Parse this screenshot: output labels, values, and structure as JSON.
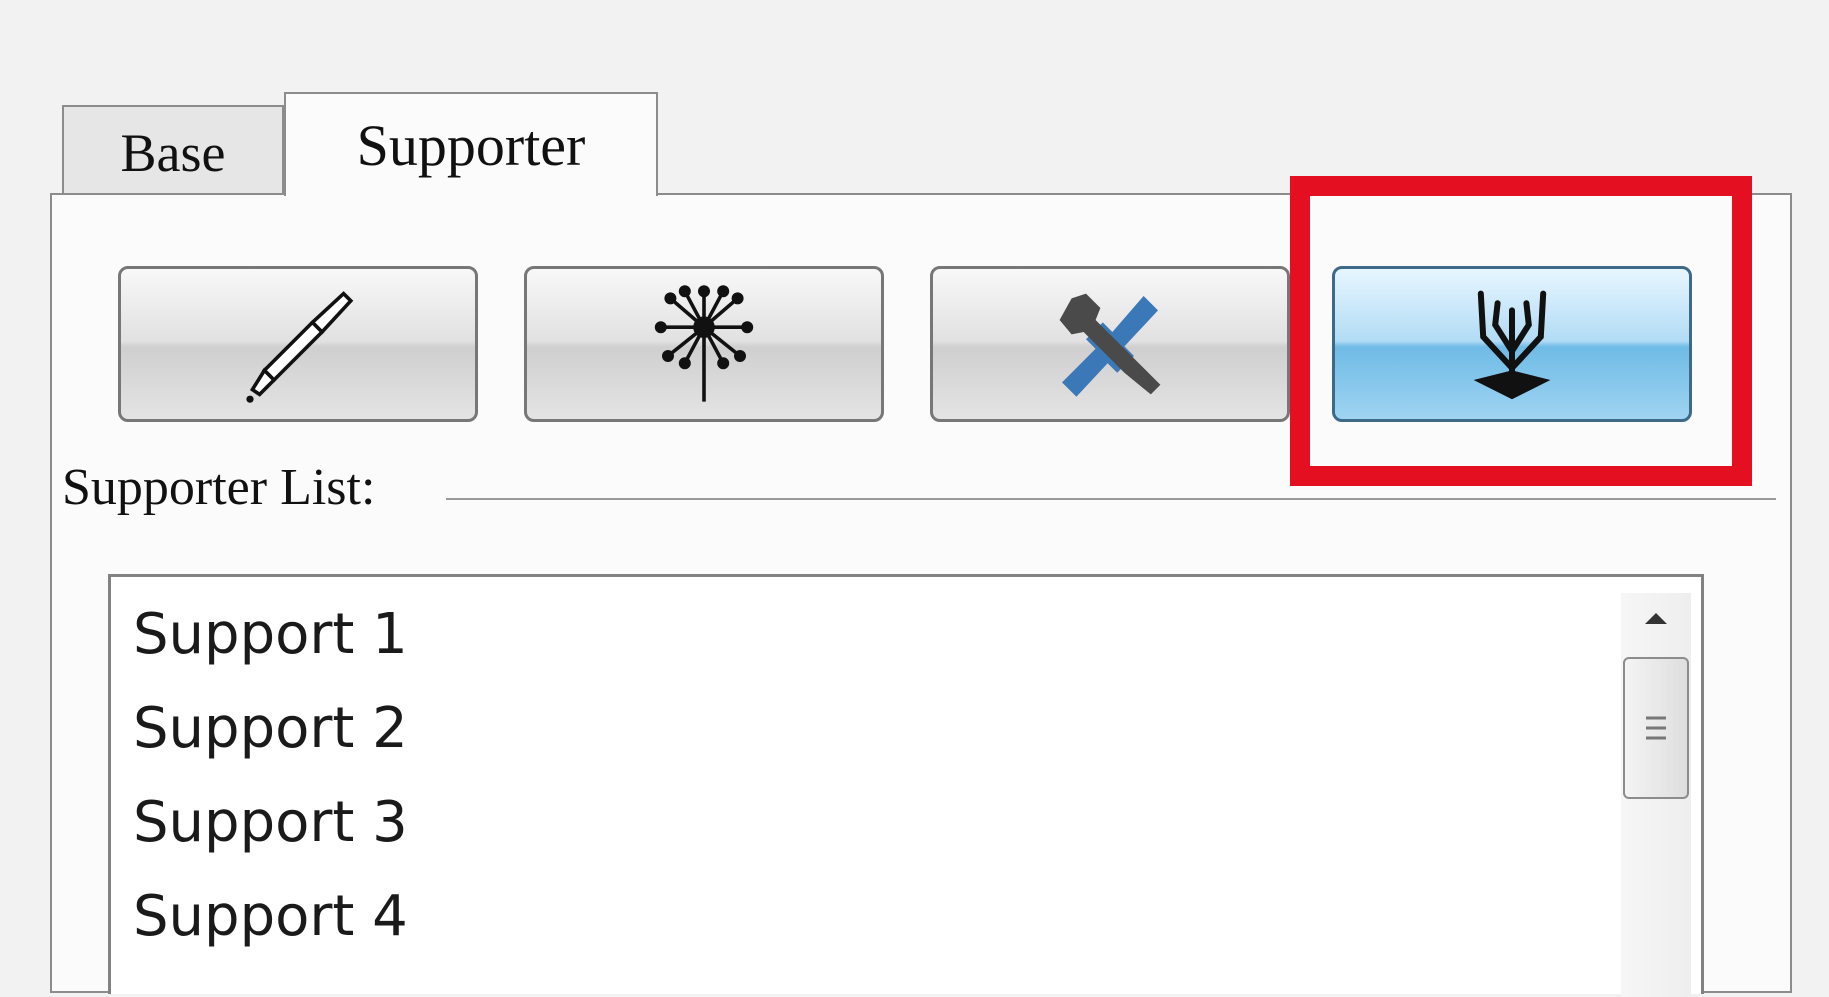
{
  "tabs": {
    "base": "Base",
    "supporter": "Supporter"
  },
  "toolbar": {
    "buttons": [
      {
        "icon": "pipette-icon"
      },
      {
        "icon": "dandelion-icon"
      },
      {
        "icon": "tools-icon"
      },
      {
        "icon": "trident-support-icon",
        "active": true
      }
    ]
  },
  "supporter_group": {
    "label": "Supporter List:"
  },
  "supporter_list": {
    "items": [
      "Support 1",
      "Support 2",
      "Support 3",
      "Support 4"
    ]
  },
  "colors": {
    "accent": "#6fbbe6",
    "highlight": "#e41021"
  }
}
